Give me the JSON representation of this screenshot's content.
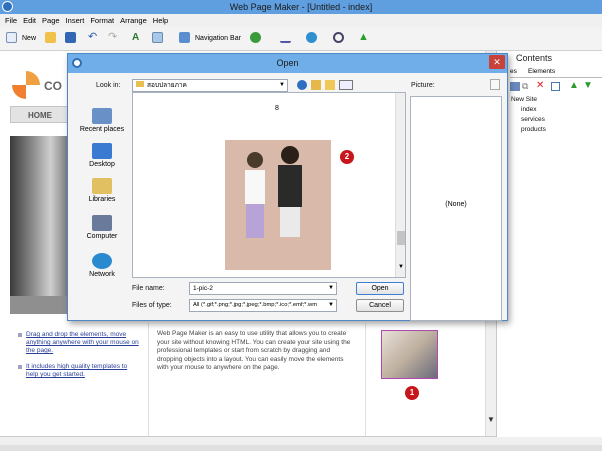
{
  "app": {
    "title": "Web Page Maker - [Untitled - index]",
    "menu": [
      "File",
      "Edit",
      "Page",
      "Insert",
      "Format",
      "Arrange",
      "Help"
    ],
    "toolbar": {
      "new_label": "New",
      "navbar_label": "Navigation Bar"
    }
  },
  "canvas": {
    "nav_home": "HOME",
    "logo_text": "CO",
    "bullet_1": "Drag and drop the elements, move anything anywhere with your mouse on the page.",
    "bullet_2": "It includes high quality templates to help you get started.",
    "body_text": "Web Page Maker is an easy to use utility that allows you to create your site without knowing HTML. You can create your site using the professional templates or start from scratch by dragging and dropping objects into a layout. You can easily move the elements with your mouse to anywhere on the page.",
    "badge_1": "1"
  },
  "right_panel": {
    "title": "Contents",
    "tab_pages": "es",
    "tab_elements": "Elements",
    "tree_root": "New Site",
    "tree_items": [
      "index",
      "services",
      "products"
    ]
  },
  "dialog": {
    "title": "Open",
    "close_glyph": "✕",
    "look_in_label": "Look in:",
    "look_in_value": "สอบปลายภาค",
    "places": [
      "Recent places",
      "Desktop",
      "Libraries",
      "Computer",
      "Network"
    ],
    "file_item_number": "8",
    "badge_2": "2",
    "picture_label": "Picture:",
    "preview_text": "(None)",
    "file_name_label": "File name:",
    "file_name_value": "1-pic-2",
    "file_type_label": "Files of type:",
    "file_type_value": "All (*.gif;*.png;*.jpg;*.jpeg;*.bmp;*.ico;*.emf;*.wm",
    "open_button": "Open",
    "cancel_button": "Cancel"
  }
}
